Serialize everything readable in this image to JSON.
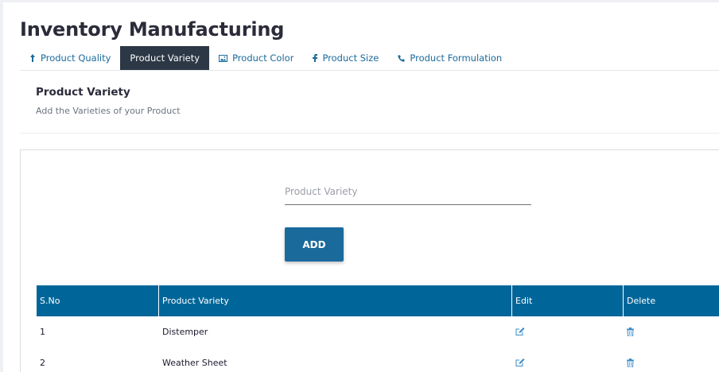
{
  "app": {
    "title": "Inventory Manufacturing"
  },
  "tabs": [
    {
      "label": "Product Quality",
      "icon": "arrow-up-icon",
      "active": false
    },
    {
      "label": "Product Variety",
      "icon": "",
      "active": true
    },
    {
      "label": "Product Color",
      "icon": "image-icon",
      "active": false
    },
    {
      "label": "Product Size",
      "icon": "facebook-icon",
      "active": false
    },
    {
      "label": "Product Formulation",
      "icon": "phone-icon",
      "active": false
    }
  ],
  "section": {
    "title": "Product Variety",
    "subtitle": "Add the Varieties of your Product"
  },
  "form": {
    "placeholder": "Product Variety",
    "value": "",
    "add_label": "ADD"
  },
  "table": {
    "headers": [
      "S.No",
      "Product Variety",
      "Edit",
      "Delete"
    ],
    "rows": [
      {
        "sno": "1",
        "variety": "Distemper"
      },
      {
        "sno": "2",
        "variety": "Weather Sheet"
      }
    ]
  },
  "colors": {
    "accent": "#1b6a9c",
    "table_header": "#006699",
    "active_tab": "#2c3845"
  }
}
